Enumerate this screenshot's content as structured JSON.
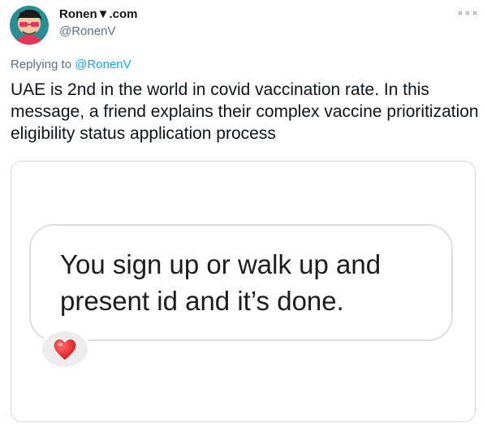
{
  "tweet": {
    "author_name": "Ronen▼.com",
    "author_handle": "@RonenV",
    "replying_prefix": "Replying to",
    "replying_handle": "@RonenV",
    "text": "UAE is 2nd in the world in covid vaccination rate. In this message, a friend explains their complex vaccine prioritization eligibility status application process",
    "more_icon": "more-options-icon"
  },
  "media": {
    "message_text": "You sign up or walk up and present id and it’s done.",
    "reaction_icon": "red-heart-icon",
    "reaction_color": "#e8202e"
  },
  "colors": {
    "link": "#1da1f2",
    "secondary_text": "#5b7083",
    "primary_text": "#0f1419"
  }
}
